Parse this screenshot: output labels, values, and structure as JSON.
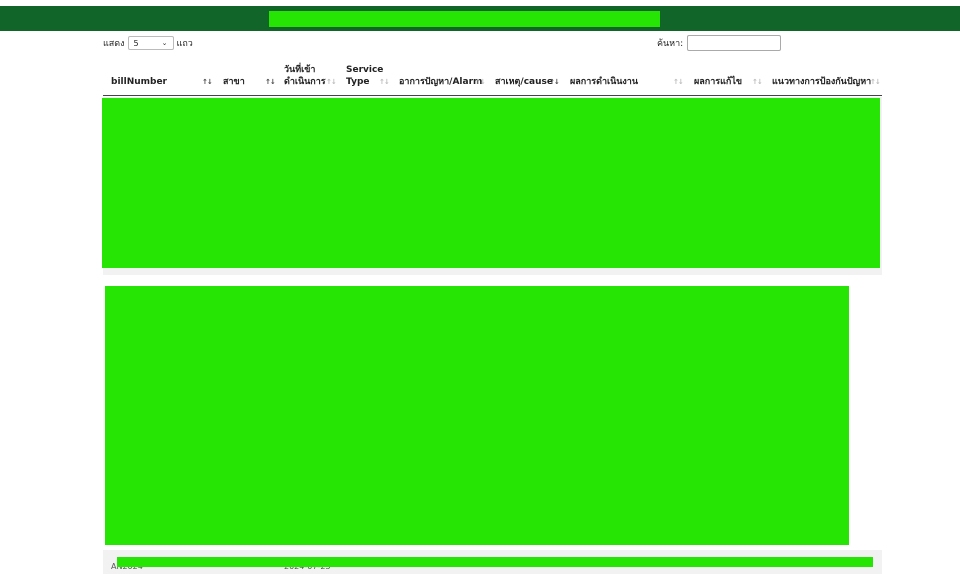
{
  "header": {
    "title": "",
    "title_redacted": true,
    "bar_color": "#116528",
    "redaction_color": "#26e404"
  },
  "length_control": {
    "show_label": "แสดง",
    "selected_value": "5",
    "rows_label": "แถว"
  },
  "search": {
    "label": "ค้นหา:",
    "value": ""
  },
  "table": {
    "columns": [
      {
        "label": "billNumber",
        "sort": "none"
      },
      {
        "label": "สาขา",
        "sort": "none"
      },
      {
        "label": "วันที่เข้าดำเนินการ",
        "sort": "none"
      },
      {
        "label": "Service Type",
        "sort": "none"
      },
      {
        "label": "อาการปัญหา/Alarm",
        "sort": "none"
      },
      {
        "label": "สาเหตุ/cause",
        "sort": "active"
      },
      {
        "label": "ผลการดำเนินงาน",
        "sort": "none"
      },
      {
        "label": "ผลการแก้ไข",
        "sort": "none"
      },
      {
        "label": "แนวทางการป้องกันปัญหา",
        "sort": "none"
      }
    ],
    "rows_redacted": true,
    "last_row_peek": {
      "bill_number": "AN2024",
      "branch": "",
      "date": "2024-07-23"
    }
  }
}
